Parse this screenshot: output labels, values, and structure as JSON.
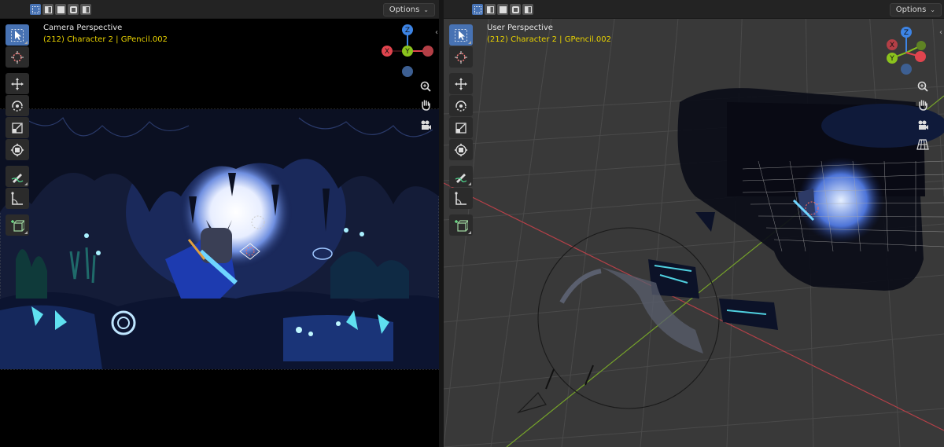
{
  "left_viewport": {
    "header": {
      "options_label": "Options",
      "modes": [
        "box-select-mode-icon",
        "extend-mode-icon",
        "subtract-mode-icon",
        "difference-mode-icon",
        "intersect-mode-icon"
      ]
    },
    "overlay": {
      "title": "Camera Perspective",
      "subtitle": "(212) Character 2 | GPencil.002"
    },
    "gizmo": {
      "z": "Z",
      "y": "Y",
      "x": "X"
    }
  },
  "right_viewport": {
    "header": {
      "options_label": "Options",
      "modes": [
        "box-select-mode-icon",
        "extend-mode-icon",
        "subtract-mode-icon",
        "difference-mode-icon",
        "intersect-mode-icon"
      ]
    },
    "overlay": {
      "title": "User Perspective",
      "subtitle": "(212) Character 2 | GPencil.002"
    },
    "gizmo": {
      "z": "Z",
      "y": "Y",
      "x": "X"
    }
  },
  "toolbar": {
    "tools": [
      "select-box-icon",
      "cursor-icon",
      "move-icon",
      "rotate-icon",
      "scale-icon",
      "transform-icon",
      "annotate-icon",
      "measure-icon",
      "add-cube-icon"
    ]
  },
  "colors": {
    "accent": "#4772b3",
    "axis_x": "#e0444e",
    "axis_y": "#8bc31d",
    "axis_z": "#3d84e5",
    "subtitle": "#e8d200"
  }
}
